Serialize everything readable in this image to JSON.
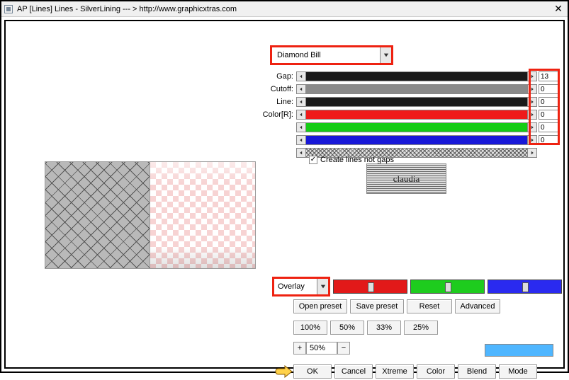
{
  "title": "AP [Lines]  Lines - SilverLining    --- >  http://www.graphicxtras.com",
  "preset_dropdown": {
    "selected": "Diamond Bill"
  },
  "params": {
    "gap": {
      "label": "Gap:",
      "value": "13",
      "bar_color": "#1a1a1a"
    },
    "cutoff": {
      "label": "Cutoff:",
      "value": "0",
      "bar_color": "#8a8a8a"
    },
    "line": {
      "label": "Line:",
      "value": "0",
      "bar_color": "#1a1a1a"
    },
    "color_r": {
      "label": "Color[R]:",
      "value": "0",
      "bar_color": "#ef1a1a"
    },
    "color_g": {
      "label": "",
      "value": "0",
      "bar_color": "#15cc15"
    },
    "color_b": {
      "label": "",
      "value": "0",
      "bar_color": "#1818d8"
    },
    "hatch": {
      "label": "",
      "value": ""
    }
  },
  "create_lines": {
    "label": "Create lines not gaps",
    "checked": true
  },
  "logo_text": "claudia",
  "blend_dropdown": {
    "selected": "Overlay"
  },
  "slider_colors": {
    "r": "#e21919",
    "g": "#1ecc1e",
    "b": "#2a2af0"
  },
  "buttons_row1": {
    "open": "Open preset",
    "save": "Save preset",
    "reset": "Reset",
    "advanced": "Advanced"
  },
  "buttons_row2": {
    "p100": "100%",
    "p50": "50%",
    "p33": "33%",
    "p25": "25%"
  },
  "zoom": {
    "plus": "+",
    "value": "50%",
    "minus": "−"
  },
  "buttons_row3": {
    "ok": "OK",
    "cancel": "Cancel",
    "xtreme": "Xtreme",
    "color": "Color",
    "blend": "Blend",
    "mode": "Mode"
  }
}
